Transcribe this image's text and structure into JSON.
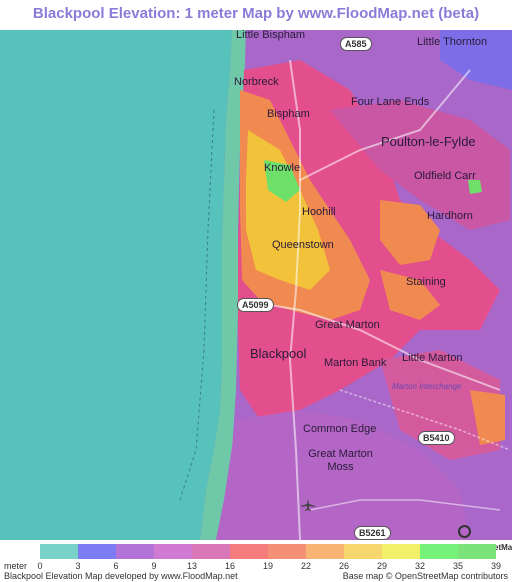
{
  "title": "Blackpool Elevation: 1 meter Map by www.FloodMap.net (beta)",
  "place_labels": [
    {
      "name": "Little Bispham",
      "size": "normal"
    },
    {
      "name": "Little Thornton",
      "size": "normal"
    },
    {
      "name": "Norbreck",
      "size": "normal"
    },
    {
      "name": "Four Lane Ends",
      "size": "normal"
    },
    {
      "name": "Bispham",
      "size": "normal"
    },
    {
      "name": "Poulton-le-Fylde",
      "size": "big"
    },
    {
      "name": "Knowle",
      "size": "normal"
    },
    {
      "name": "Oldfield Carr",
      "size": "normal"
    },
    {
      "name": "Hoohill",
      "size": "normal"
    },
    {
      "name": "Hardhorn",
      "size": "normal"
    },
    {
      "name": "Queenstown",
      "size": "normal"
    },
    {
      "name": "Staining",
      "size": "normal"
    },
    {
      "name": "Great Marton",
      "size": "normal"
    },
    {
      "name": "Blackpool",
      "size": "big"
    },
    {
      "name": "Marton Bank",
      "size": "normal"
    },
    {
      "name": "Little Marton",
      "size": "normal"
    },
    {
      "name": "Common Edge",
      "size": "normal"
    },
    {
      "name": "Great Marton Moss",
      "size": "normal"
    }
  ],
  "road_labels": [
    "A585",
    "A5099",
    "B5410",
    "B5261"
  ],
  "small_labels": [
    "Marton Interchange"
  ],
  "osm_badge": "OpenStreetMap",
  "legend": {
    "unit": "meter",
    "ticks": [
      "0",
      "3",
      "6",
      "9",
      "13",
      "16",
      "19",
      "22",
      "26",
      "29",
      "32",
      "35",
      "39"
    ],
    "colors": [
      "#79d2c8",
      "#7e7cf2",
      "#b274d6",
      "#d07ad4",
      "#d878b8",
      "#f47c7c",
      "#f49076",
      "#f8b472",
      "#f6d66e",
      "#f2f068",
      "#76f27a",
      "#7ce27a"
    ]
  },
  "footer": {
    "left": "Blackpool Elevation Map developed by www.FloodMap.net",
    "right": "Base map © OpenStreetMap contributors"
  },
  "map_colors": {
    "sea": "#56c2bb",
    "low": "#b96bc9",
    "mid": "#e6508a",
    "high": "#f2c23a",
    "peak": "#6ee06a"
  }
}
